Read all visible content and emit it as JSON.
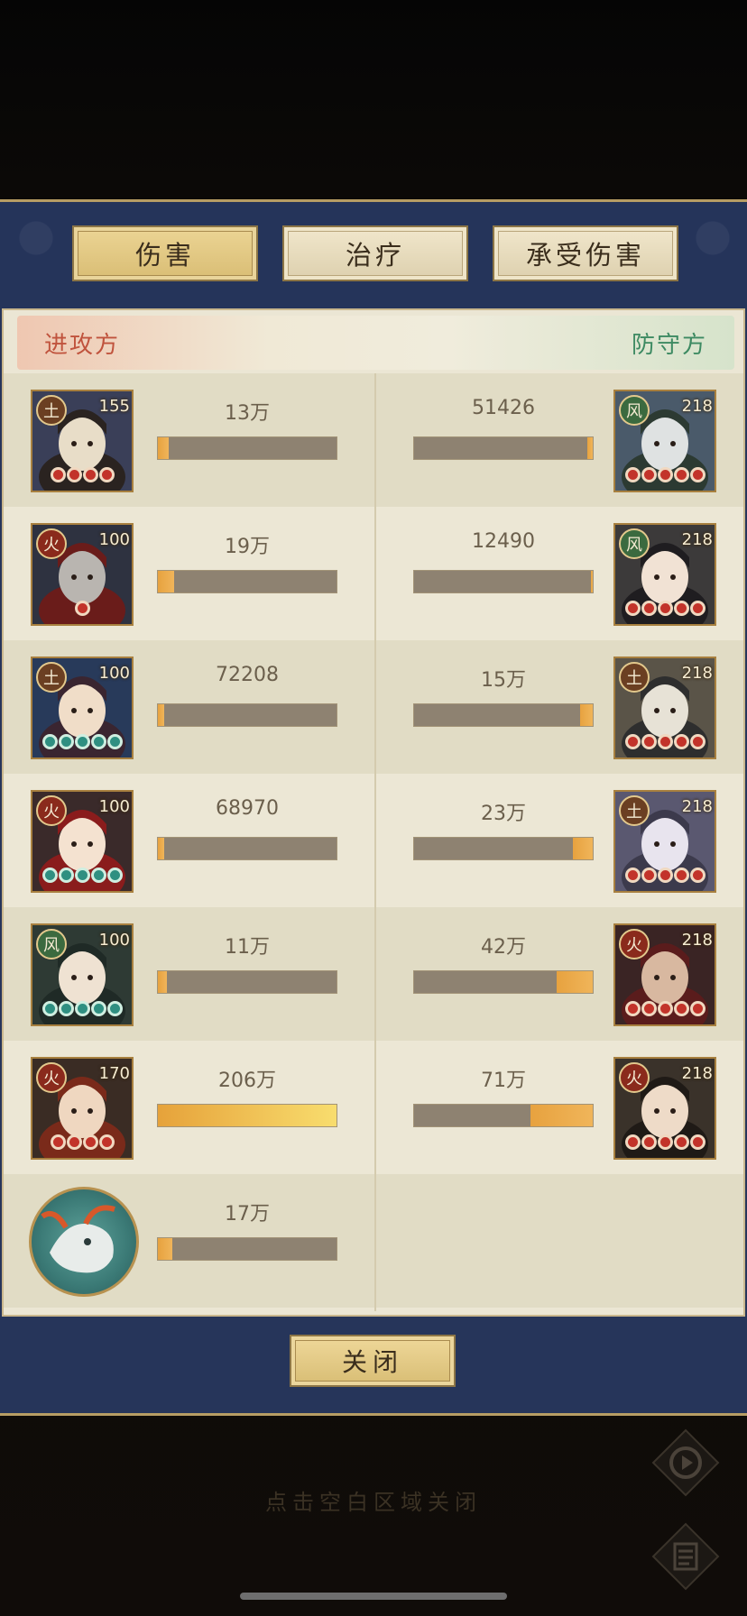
{
  "tabs": [
    {
      "label": "伤害",
      "active": true
    },
    {
      "label": "治疗",
      "active": false
    },
    {
      "label": "承受伤害",
      "active": false
    }
  ],
  "sides": {
    "attacker": "进攻方",
    "defender": "防守方"
  },
  "rows": [
    {
      "attacker": {
        "element": "土",
        "element_color": "#6b3f22",
        "level": "155",
        "stars": 4,
        "star_color": "red",
        "value": "13万",
        "bar_fraction": 0.06
      },
      "defender": {
        "element": "风",
        "element_color": "#3b6a3f",
        "level": "218",
        "stars": 5,
        "star_color": "red",
        "value": "51426",
        "bar_fraction": 0.03
      }
    },
    {
      "attacker": {
        "element": "火",
        "element_color": "#8a2a1c",
        "level": "100",
        "stars": 1,
        "star_color": "red",
        "value": "19万",
        "bar_fraction": 0.09
      },
      "defender": {
        "element": "风",
        "element_color": "#3b6a3f",
        "level": "218",
        "stars": 5,
        "star_color": "red",
        "value": "12490",
        "bar_fraction": 0.01
      }
    },
    {
      "attacker": {
        "element": "土",
        "element_color": "#6b3f22",
        "level": "100",
        "stars": 5,
        "star_color": "teal",
        "value": "72208",
        "bar_fraction": 0.035
      },
      "defender": {
        "element": "土",
        "element_color": "#6b3f22",
        "level": "218",
        "stars": 5,
        "star_color": "red",
        "value": "15万",
        "bar_fraction": 0.07
      }
    },
    {
      "attacker": {
        "element": "火",
        "element_color": "#8a2a1c",
        "level": "100",
        "stars": 5,
        "star_color": "teal",
        "value": "68970",
        "bar_fraction": 0.033
      },
      "defender": {
        "element": "土",
        "element_color": "#6b3f22",
        "level": "218",
        "stars": 5,
        "star_color": "red",
        "value": "23万",
        "bar_fraction": 0.11
      }
    },
    {
      "attacker": {
        "element": "风",
        "element_color": "#3b6a3f",
        "level": "100",
        "stars": 5,
        "star_color": "teal",
        "value": "11万",
        "bar_fraction": 0.053
      },
      "defender": {
        "element": "火",
        "element_color": "#8a2a1c",
        "level": "218",
        "stars": 5,
        "star_color": "red",
        "value": "42万",
        "bar_fraction": 0.2
      }
    },
    {
      "attacker": {
        "element": "火",
        "element_color": "#8a2a1c",
        "level": "170",
        "stars": 4,
        "star_color": "red",
        "value": "206万",
        "bar_fraction": 1.0
      },
      "defender": {
        "element": "火",
        "element_color": "#8a2a1c",
        "level": "218",
        "stars": 5,
        "star_color": "red",
        "value": "71万",
        "bar_fraction": 0.35
      }
    }
  ],
  "pet": {
    "value": "17万",
    "bar_fraction": 0.08
  },
  "close_label": "关闭",
  "hint": "点击空白区域关闭",
  "icons": {
    "replay": "replay-icon",
    "log": "battle-log-icon"
  }
}
